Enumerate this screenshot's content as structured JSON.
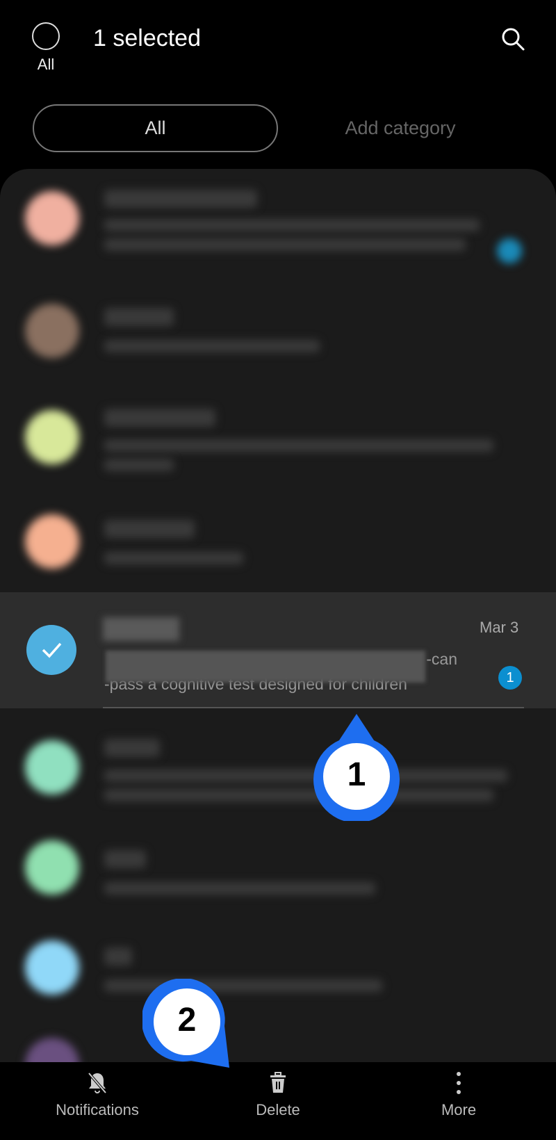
{
  "header": {
    "select_all_label": "All",
    "title": "1 selected",
    "search_icon": "search-icon"
  },
  "tabs": [
    {
      "label": "All",
      "active": true
    },
    {
      "label": "Add category",
      "active": false
    }
  ],
  "selected_conversation": {
    "date": "Mar 3",
    "message_visible": "-can\n-pass a cognitive test designed for children",
    "unread_count": "1"
  },
  "bottom_bar": [
    {
      "label": "Notifications",
      "icon": "bell-off-icon"
    },
    {
      "label": "Delete",
      "icon": "trash-icon"
    },
    {
      "label": "More",
      "icon": "more-vertical-icon"
    }
  ],
  "callouts": [
    {
      "label": "1"
    },
    {
      "label": "2"
    }
  ],
  "colors": {
    "accent": "#1e6ef0",
    "check": "#4fb0e0",
    "badge": "#0b8fd0"
  }
}
